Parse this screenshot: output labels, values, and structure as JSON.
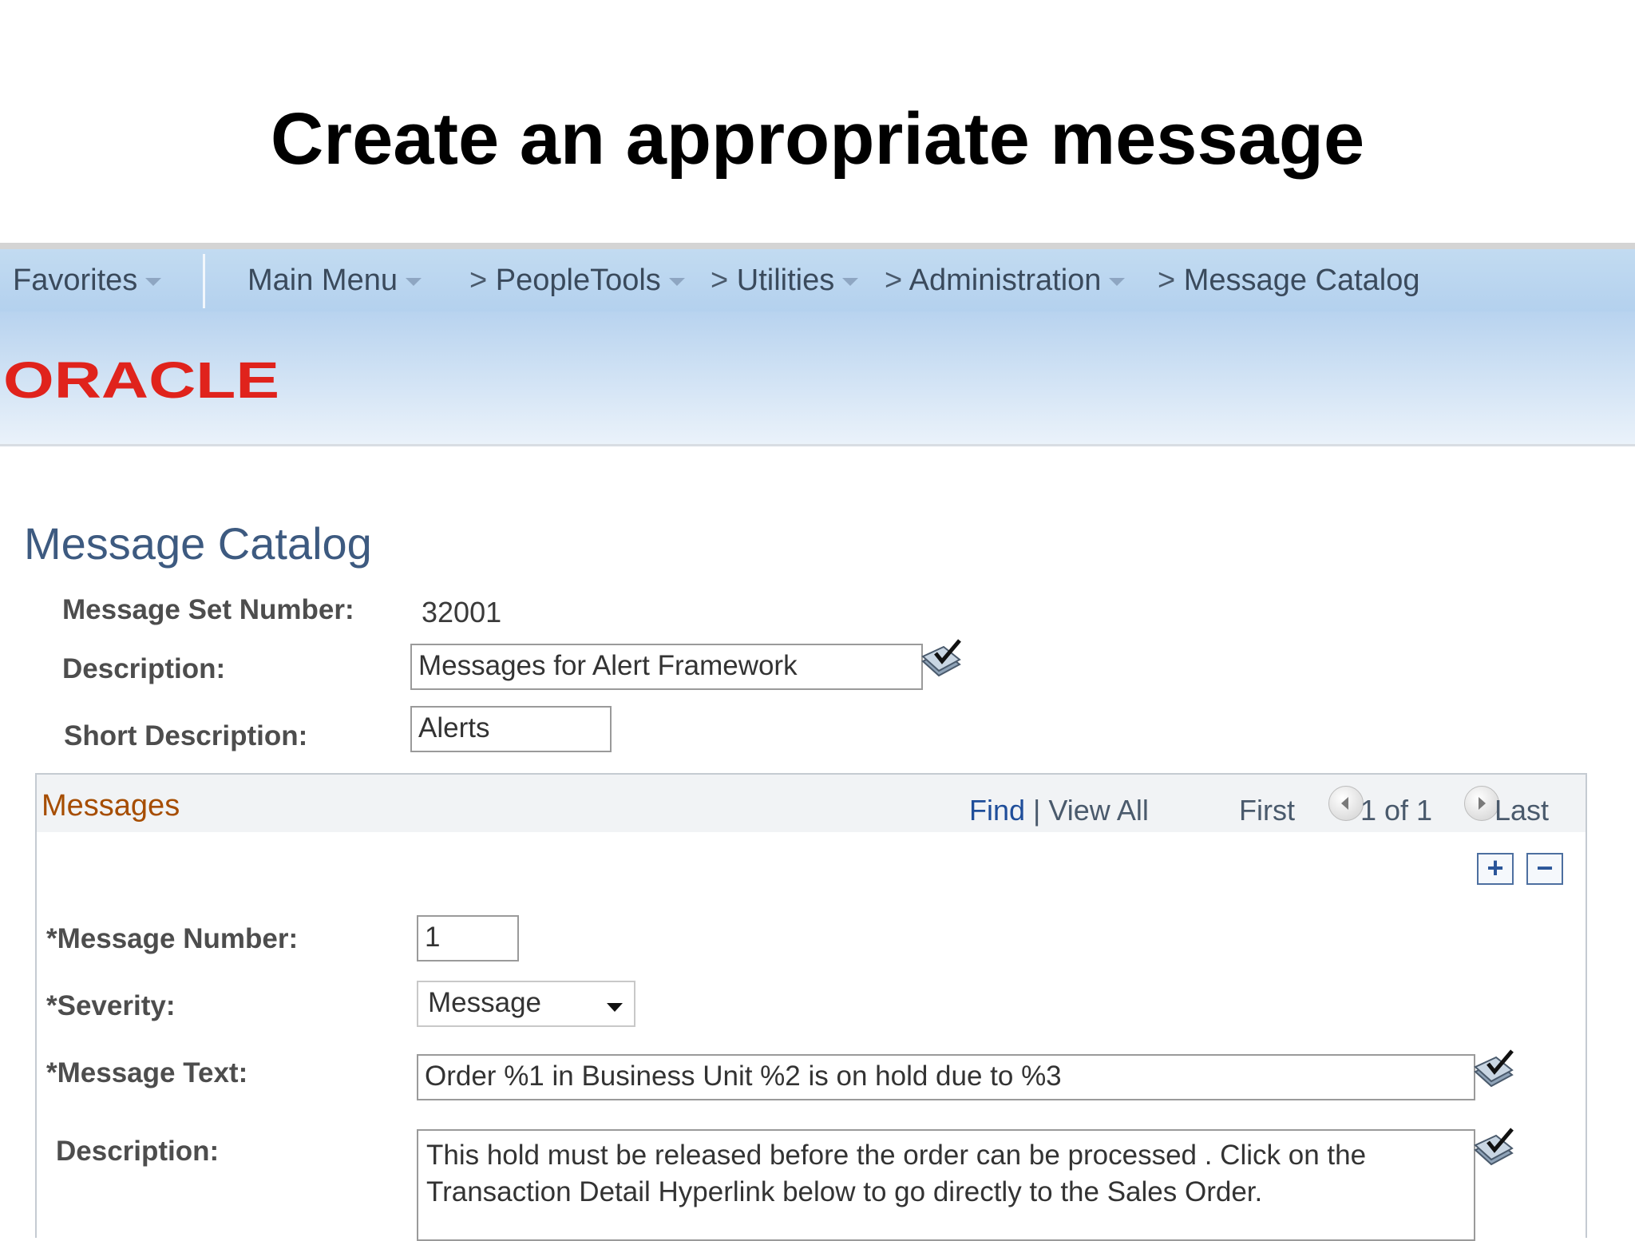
{
  "slide": {
    "title": "Create an appropriate message"
  },
  "nav": {
    "favorites": "Favorites",
    "main_menu": "Main Menu",
    "breadcrumb": [
      "PeopleTools",
      "Utilities",
      "Administration",
      "Message Catalog"
    ],
    "separator": ">"
  },
  "brand": {
    "logo_text": "ORACLE"
  },
  "page": {
    "title": "Message Catalog",
    "message_set_number_label": "Message Set Number:",
    "message_set_number": "32001",
    "description_label": "Description:",
    "description_value": "Messages for Alert Framework",
    "short_description_label": "Short Description:",
    "short_description_value": "Alerts"
  },
  "messages": {
    "heading": "Messages",
    "find": "Find",
    "pipe": "|",
    "view_all": "View All",
    "first": "First",
    "page_of": "1 of 1",
    "last": "Last",
    "add_symbol": "+",
    "remove_symbol": "−",
    "message_number_label": "*Message Number:",
    "message_number_value": "1",
    "severity_label": "*Severity:",
    "severity_value": "Message",
    "message_text_label": "*Message Text:",
    "message_text_value": "Order %1 in Business Unit %2 is on hold due to %3",
    "description_label": "Description:",
    "description_value": "This hold must be released before the order can be processed .  Click on the Transaction Detail Hyperlink below to go directly to the Sales Order."
  },
  "colors": {
    "nav_bg": "#b9d5f0",
    "oracle_red": "#e0231c",
    "title_blue": "#3d5a80",
    "messages_heading": "#a64d00",
    "link_blue": "#1f4e9a"
  },
  "icons": [
    "chevron-down-icon",
    "chevron-right-icon",
    "edit-translate-icon",
    "prev-arrow-icon",
    "next-arrow-icon",
    "add-row-icon",
    "delete-row-icon",
    "dropdown-caret-icon"
  ]
}
